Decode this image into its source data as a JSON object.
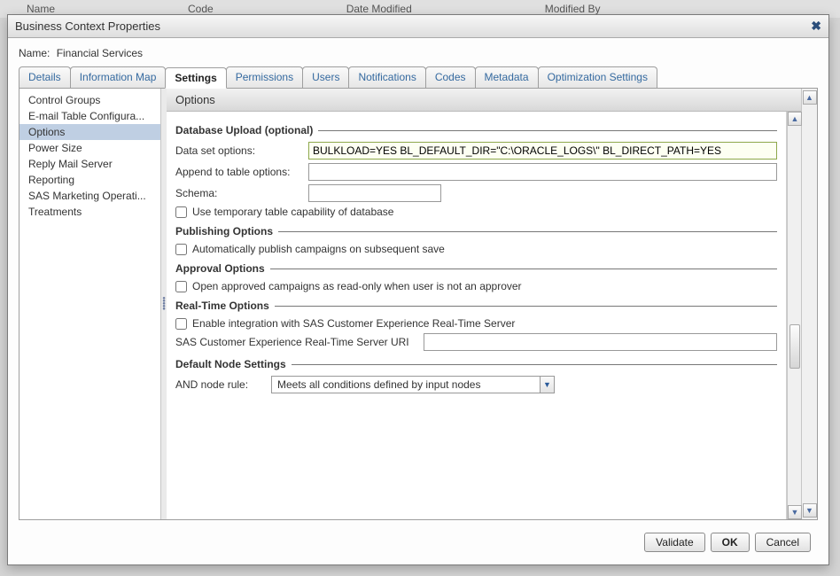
{
  "bg_headers": [
    "Name",
    "Code",
    "Date Modified",
    "Modified By"
  ],
  "dialog_title": "Business Context Properties",
  "name_label": "Name:",
  "name_value": "Financial Services",
  "tabs": [
    "Details",
    "Information Map",
    "Settings",
    "Permissions",
    "Users",
    "Notifications",
    "Codes",
    "Metadata",
    "Optimization Settings"
  ],
  "tab_active_index": 2,
  "sidebar": {
    "items": [
      "Control Groups",
      "E-mail Table Configura...",
      "Options",
      "Power Size",
      "Reply Mail Server",
      "Reporting",
      "SAS Marketing Operati...",
      "Treatments"
    ],
    "selected_index": 2
  },
  "pane_header": "Options",
  "sections": {
    "db_upload": {
      "title": "Database Upload (optional)",
      "data_set_label": "Data set options:",
      "data_set_value": "BULKLOAD=YES BL_DEFAULT_DIR=\"C:\\ORACLE_LOGS\\\" BL_DIRECT_PATH=YES",
      "append_label": "Append to table options:",
      "append_value": "",
      "schema_label": "Schema:",
      "schema_value": "",
      "temp_table_cb": "Use temporary table capability of database"
    },
    "publishing": {
      "title": "Publishing Options",
      "auto_publish_cb": "Automatically publish campaigns on subsequent save"
    },
    "approval": {
      "title": "Approval Options",
      "approval_cb": "Open approved campaigns as read-only when user is not an approver"
    },
    "realtime": {
      "title": "Real-Time Options",
      "enable_cb": "Enable integration with SAS Customer Experience Real-Time Server",
      "uri_label": "SAS Customer Experience Real-Time Server URI",
      "uri_value": ""
    },
    "default_node": {
      "title": "Default Node Settings",
      "and_label": "AND node rule:",
      "and_value": "Meets all conditions defined by input nodes"
    }
  },
  "footer": {
    "validate": "Validate",
    "ok": "OK",
    "cancel": "Cancel"
  }
}
